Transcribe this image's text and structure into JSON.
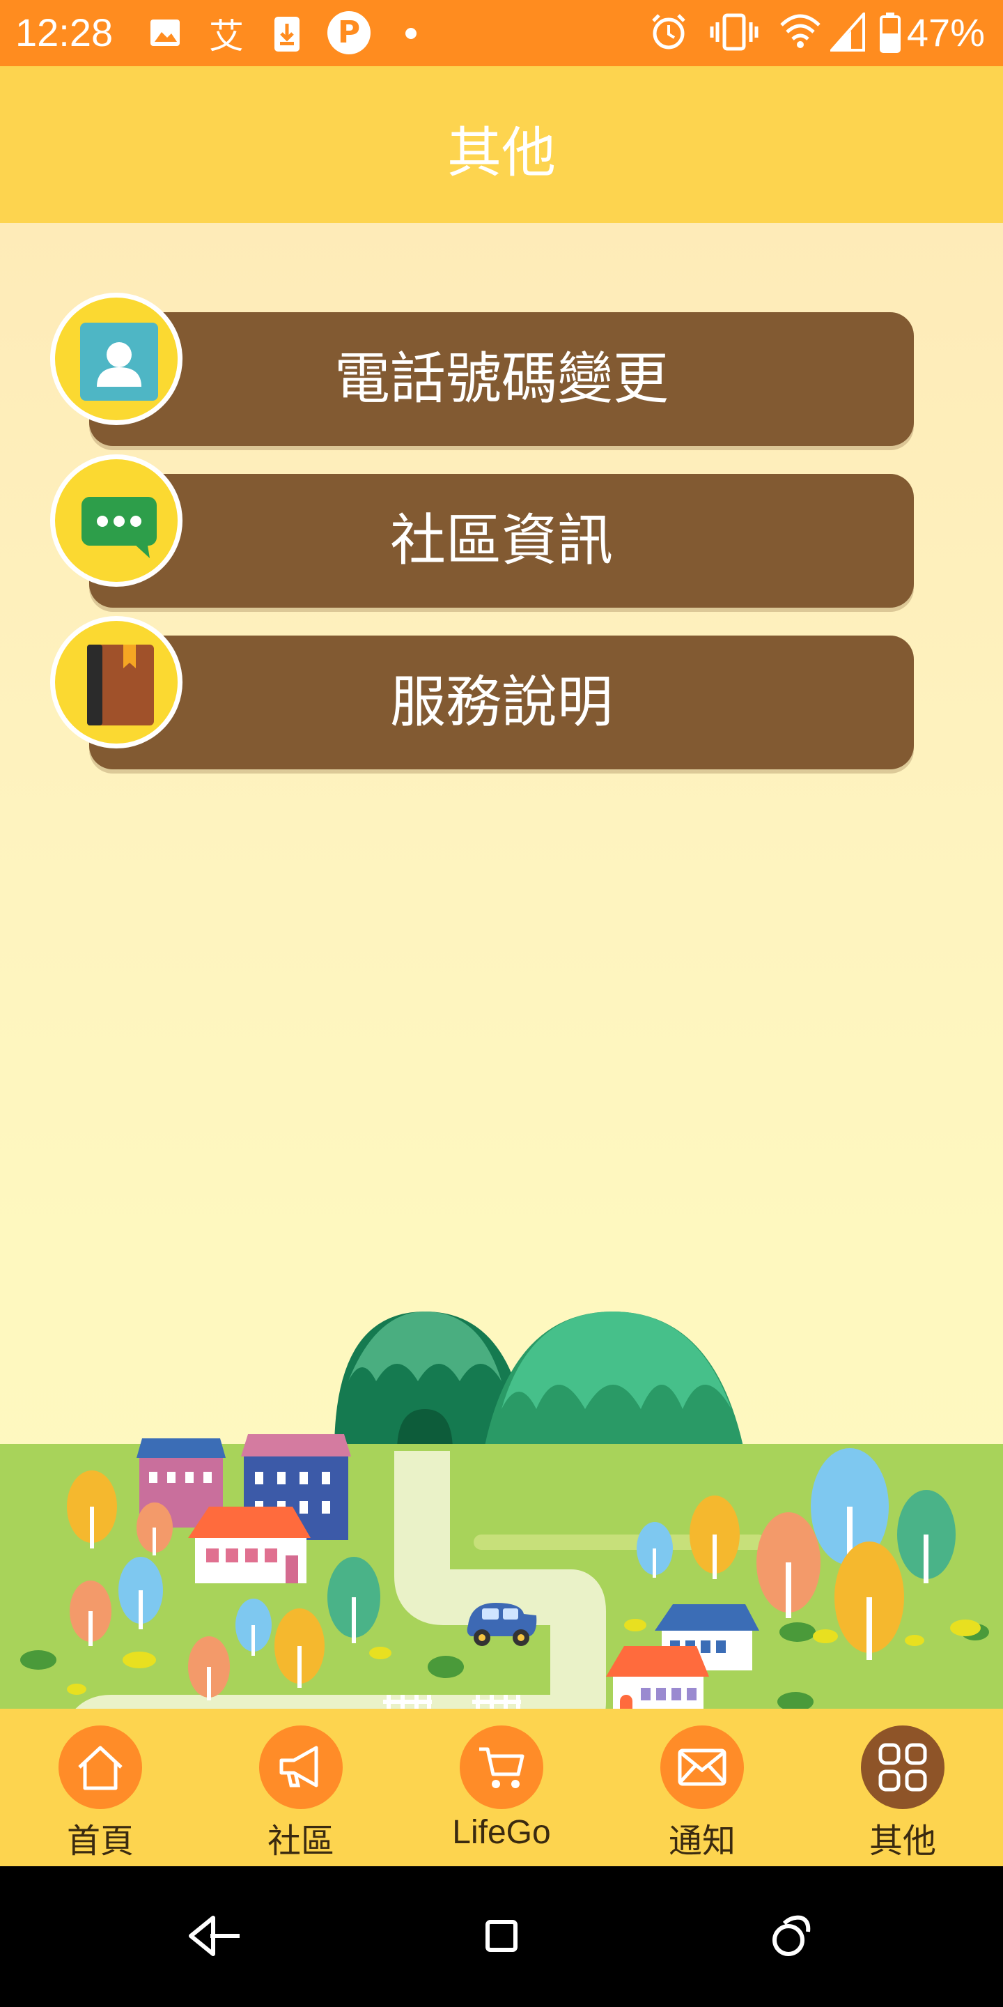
{
  "status_bar": {
    "time": "12:28",
    "notification_text_icon": "艾",
    "notification_p_icon": "P",
    "battery_percent": "47%",
    "icons": [
      "image-icon",
      "text-icon",
      "download-icon",
      "p-app-icon",
      "dot-icon",
      "alarm-icon",
      "vibrate-icon",
      "wifi-icon",
      "signal-icon",
      "battery-icon"
    ]
  },
  "header": {
    "title": "其他"
  },
  "menu": {
    "items": [
      {
        "label": "電話號碼變更",
        "icon": "contact-card-icon"
      },
      {
        "label": "社區資訊",
        "icon": "chat-bubble-icon"
      },
      {
        "label": "服務說明",
        "icon": "book-icon"
      }
    ]
  },
  "bottom_nav": {
    "items": [
      {
        "label": "首頁",
        "icon": "home-icon"
      },
      {
        "label": "社區",
        "icon": "megaphone-icon"
      },
      {
        "label": "LifeGo",
        "icon": "cart-icon"
      },
      {
        "label": "通知",
        "icon": "mail-icon"
      },
      {
        "label": "其他",
        "icon": "grid-icon",
        "active": true
      }
    ]
  },
  "colors": {
    "status_bar": "#ff8c1f",
    "header": "#fdd44f",
    "menu_pill": "#825a32",
    "icon_circle": "#fbd931",
    "nav_icon": "#ff8c28",
    "nav_icon_active": "#8e5428"
  }
}
